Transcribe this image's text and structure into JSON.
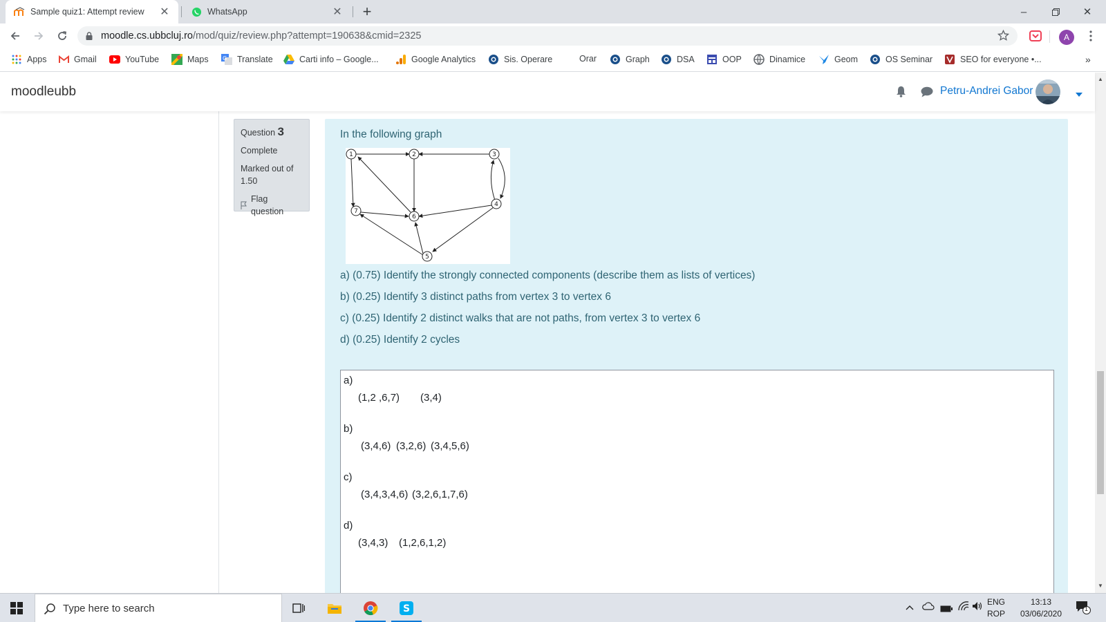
{
  "browser": {
    "tabs": [
      {
        "title": "Sample quiz1: Attempt review",
        "active": true
      },
      {
        "title": "WhatsApp",
        "active": false
      }
    ],
    "url_host": "moodle.cs.ubbcluj.ro",
    "url_path": "/mod/quiz/review.php?attempt=190638&cmid=2325",
    "profile_initial": "A"
  },
  "bookmarks": [
    "Apps",
    "Gmail",
    "YouTube",
    "Maps",
    "Translate",
    "Carti info – Google...",
    "Google Analytics",
    "Sis. Operare",
    "Orar",
    "Graph",
    "DSA",
    "OOP",
    "Dinamice",
    "Geom",
    "OS Seminar",
    "SEO for everyone •..."
  ],
  "moodle": {
    "brand": "moodleubb",
    "user_name": "Petru-Andrei Gabor"
  },
  "question": {
    "label": "Question",
    "number": "3",
    "state": "Complete",
    "mark": "Marked out of 1.50",
    "flag": "Flag question",
    "intro": "In the following graph",
    "items": [
      "a) (0.75) Identify the strongly connected components (describe them as lists of vertices)",
      "b) (0.25) Identify 3 distinct paths from vertex 3 to vertex 6",
      "c) (0.25) Identify 2 distinct walks that are not paths, from vertex 3 to vertex 6",
      "d) (0.25) Identify 2 cycles"
    ],
    "graph_labels": [
      "1",
      "2",
      "3",
      "4",
      "5",
      "6",
      "7"
    ]
  },
  "answer": {
    "a_label": "a)",
    "a_values": [
      "(1,2 ,6,7)",
      "(3,4)"
    ],
    "b_label": "b)",
    "b_values": [
      "(3,4,6)",
      "(3,2,6)",
      "(3,4,5,6)"
    ],
    "c_label": "c)",
    "c_values": [
      "(3,4,3,4,6)",
      "(3,2,6,1,7,6)"
    ],
    "d_label": "d)",
    "d_values": [
      "(3,4,3)",
      "(1,2,6,1,2)"
    ]
  },
  "taskbar": {
    "search_placeholder": "Type here to search",
    "lang_top": "ENG",
    "lang_bottom": "ROP",
    "time": "13:13",
    "date": "03/06/2020",
    "notif_count": "1"
  },
  "colors": {
    "moodle_link": "#1177d1",
    "question_bg": "#def2f8",
    "question_text": "#2f6473",
    "info_bg": "#dee2e6"
  }
}
